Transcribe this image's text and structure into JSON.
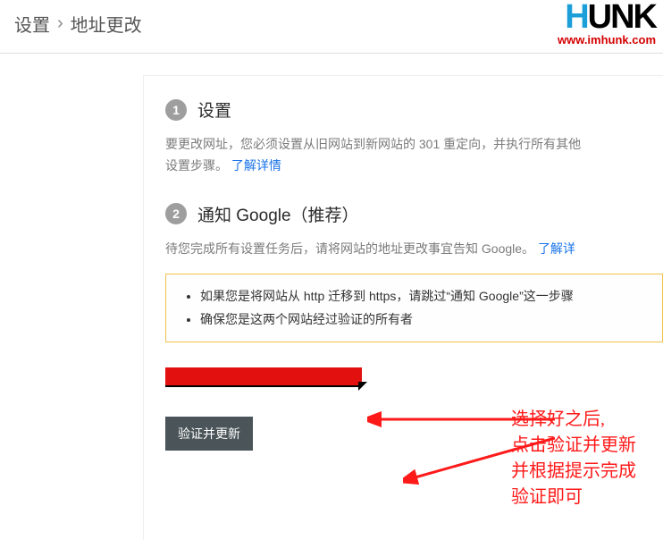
{
  "breadcrumb": {
    "root": "设置",
    "current": "地址更改"
  },
  "brand": {
    "logo_text_pre": "H",
    "logo_text_rest": "UNK",
    "url": "www.imhunk.com"
  },
  "step1": {
    "num": "1",
    "title": "设置",
    "desc_a": "要更改网址，您必须设置从旧网站到新网站的 301 重定向，并执行所有其他",
    "desc_b": "设置步骤。",
    "link": "了解详情"
  },
  "step2": {
    "num": "2",
    "title": "通知 Google（推荐）",
    "desc": "待您完成所有设置任务后，请将网站的地址更改事宜告知 Google。",
    "link": "了解详",
    "notice1": "如果您是将网站从 http 迁移到 https，请跳过“通知 Google”这一步骤",
    "notice2": "确保您是这两个网站经过验证的所有者"
  },
  "button": {
    "label": "验证并更新"
  },
  "annotation": {
    "l1": "选择好之后,",
    "l2": "点击验证并更新",
    "l3": "并根据提示完成",
    "l4": "验证即可"
  }
}
